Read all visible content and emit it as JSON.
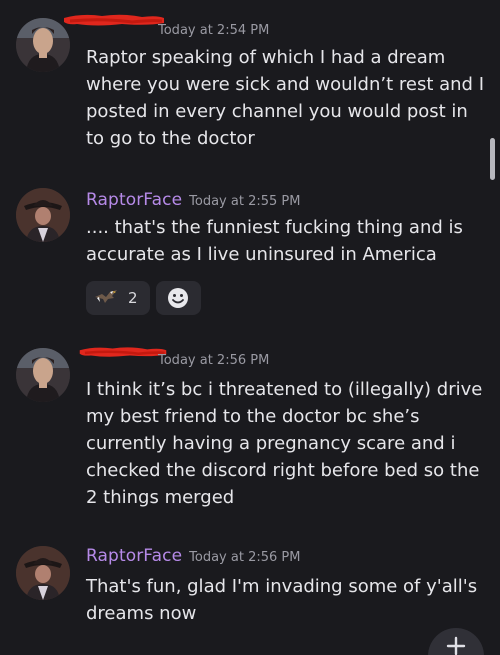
{
  "messages": [
    {
      "username": "",
      "username_redacted": true,
      "timestamp": "Today at 2:54 PM",
      "text": "Raptor speaking of which I had a dream where you were sick and wouldn’t rest and I posted in every channel you would post in to go to the doctor"
    },
    {
      "username": "RaptorFace",
      "username_color": "#b68ae8",
      "timestamp": "Today at 2:55 PM",
      "text": ".... that's the funniest fucking thing and is accurate as I live uninsured in America",
      "reactions": [
        {
          "icon": "eagle-emoji-icon",
          "count": "2"
        },
        {
          "icon": "add-reaction-icon"
        }
      ]
    },
    {
      "username": "",
      "username_redacted": true,
      "timestamp": "Today at 2:56 PM",
      "text": "I think it’s bc i threatened to (illegally) drive my best friend to the doctor bc she’s currently having a pregnancy scare and i checked the discord right before bed so the 2 things merged"
    },
    {
      "username": "RaptorFace",
      "username_color": "#b68ae8",
      "timestamp": "Today at 2:56 PM",
      "text": "That's fun, glad I'm invading some of y'all's dreams now"
    }
  ],
  "colors": {
    "background": "#1a1a1e",
    "redaction": "#e0271d",
    "username_raptorface": "#b68ae8",
    "timestamp": "#9a9aa3"
  },
  "icons": {
    "scroll_to_bottom": "plus-icon"
  }
}
